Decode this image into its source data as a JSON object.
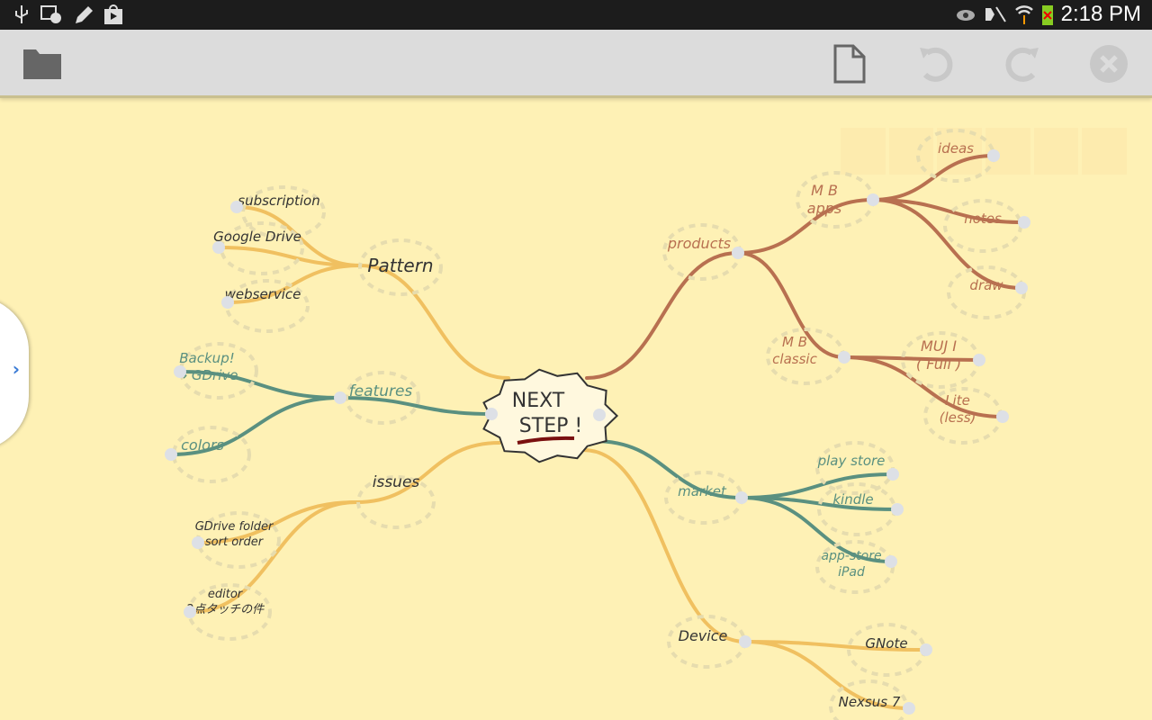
{
  "status_bar": {
    "time": "2:18 PM",
    "left_icons": [
      "usb-icon",
      "alarm-icon",
      "edit-icon",
      "play-store-icon"
    ],
    "right_icons": [
      "eye-icon",
      "mute-icon",
      "wifi-icon",
      "battery-icon"
    ]
  },
  "toolbar": {
    "icons": [
      "folder-icon",
      "new-file-icon",
      "undo-icon",
      "redo-icon",
      "close-icon"
    ]
  },
  "colors": {
    "background": "#fef1b5",
    "orange": "#f0c060",
    "brown": "#b87050",
    "teal": "#5a9080"
  },
  "mindmap": {
    "center": [
      "NEXT",
      "STEP !"
    ],
    "branches": {
      "pattern": {
        "label": "Pattern",
        "children": [
          "subscription",
          "Google Drive",
          "webservice"
        ]
      },
      "features": {
        "label": "features",
        "children": [
          "Backup!|→ GDrive",
          "colors"
        ]
      },
      "issues": {
        "label": "issues",
        "children": [
          "GDrive folder|sort order",
          "editor|2点タッチの件"
        ]
      },
      "products": {
        "label": "products",
        "mb_apps": {
          "label": "M B|apps",
          "children": [
            "ideas",
            "notes",
            "draw"
          ]
        },
        "mb_classic": {
          "label": "M B|classic",
          "children": [
            "MUJ I|( Full )",
            "Lite|(less)"
          ]
        }
      },
      "market": {
        "label": "market",
        "children": [
          "play store",
          "kindle",
          "app-store|iPad"
        ]
      },
      "device": {
        "label": "Device",
        "children": [
          "GNote",
          "Nexsus 7"
        ]
      }
    }
  }
}
